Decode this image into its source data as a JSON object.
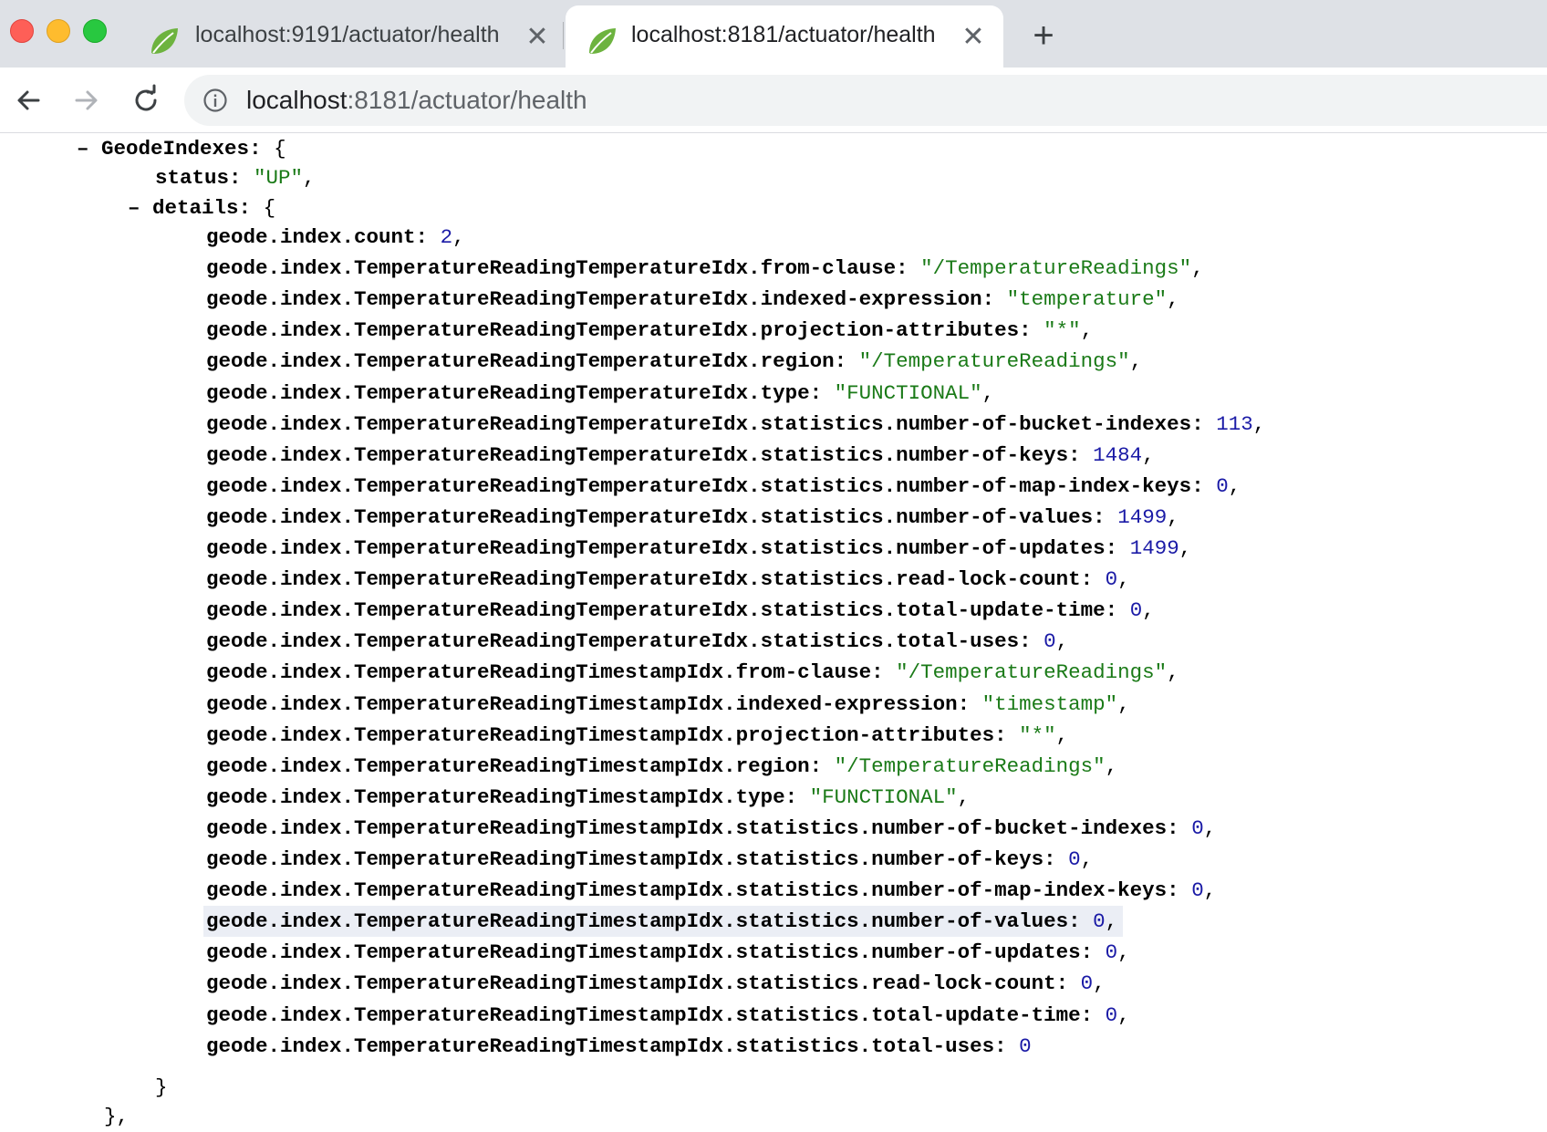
{
  "tabs": [
    {
      "title": "localhost:9191/actuator/health",
      "close": "✕"
    },
    {
      "title": "localhost:8181/actuator/health",
      "close": "✕"
    }
  ],
  "new_tab": "+",
  "address_bar": {
    "host": "localhost",
    "path": ":8181/actuator/health"
  },
  "json": {
    "collapse_toggle": "–",
    "group_key": "GeodeIndexes",
    "status_key": "status",
    "status_value": "\"UP\"",
    "details_key": "details",
    "open_brace": "{",
    "close_brace": "}",
    "close_brace_comma": "},",
    "entries": [
      {
        "key": "geode.index.count",
        "value": "2",
        "type": "num",
        "comma": ","
      },
      {
        "key": "geode.index.TemperatureReadingTemperatureIdx.from-clause",
        "value": "\"/TemperatureReadings\"",
        "type": "str",
        "comma": ","
      },
      {
        "key": "geode.index.TemperatureReadingTemperatureIdx.indexed-expression",
        "value": "\"temperature\"",
        "type": "str",
        "comma": ","
      },
      {
        "key": "geode.index.TemperatureReadingTemperatureIdx.projection-attributes",
        "value": "\"*\"",
        "type": "str",
        "comma": ","
      },
      {
        "key": "geode.index.TemperatureReadingTemperatureIdx.region",
        "value": "\"/TemperatureReadings\"",
        "type": "str",
        "comma": ","
      },
      {
        "key": "geode.index.TemperatureReadingTemperatureIdx.type",
        "value": "\"FUNCTIONAL\"",
        "type": "str",
        "comma": ","
      },
      {
        "key": "geode.index.TemperatureReadingTemperatureIdx.statistics.number-of-bucket-indexes",
        "value": "113",
        "type": "num",
        "comma": ","
      },
      {
        "key": "geode.index.TemperatureReadingTemperatureIdx.statistics.number-of-keys",
        "value": "1484",
        "type": "num",
        "comma": ","
      },
      {
        "key": "geode.index.TemperatureReadingTemperatureIdx.statistics.number-of-map-index-keys",
        "value": "0",
        "type": "num",
        "comma": ","
      },
      {
        "key": "geode.index.TemperatureReadingTemperatureIdx.statistics.number-of-values",
        "value": "1499",
        "type": "num",
        "comma": ","
      },
      {
        "key": "geode.index.TemperatureReadingTemperatureIdx.statistics.number-of-updates",
        "value": "1499",
        "type": "num",
        "comma": ","
      },
      {
        "key": "geode.index.TemperatureReadingTemperatureIdx.statistics.read-lock-count",
        "value": "0",
        "type": "num",
        "comma": ","
      },
      {
        "key": "geode.index.TemperatureReadingTemperatureIdx.statistics.total-update-time",
        "value": "0",
        "type": "num",
        "comma": ","
      },
      {
        "key": "geode.index.TemperatureReadingTemperatureIdx.statistics.total-uses",
        "value": "0",
        "type": "num",
        "comma": ","
      },
      {
        "key": "geode.index.TemperatureReadingTimestampIdx.from-clause",
        "value": "\"/TemperatureReadings\"",
        "type": "str",
        "comma": ","
      },
      {
        "key": "geode.index.TemperatureReadingTimestampIdx.indexed-expression",
        "value": "\"timestamp\"",
        "type": "str",
        "comma": ","
      },
      {
        "key": "geode.index.TemperatureReadingTimestampIdx.projection-attributes",
        "value": "\"*\"",
        "type": "str",
        "comma": ","
      },
      {
        "key": "geode.index.TemperatureReadingTimestampIdx.region",
        "value": "\"/TemperatureReadings\"",
        "type": "str",
        "comma": ","
      },
      {
        "key": "geode.index.TemperatureReadingTimestampIdx.type",
        "value": "\"FUNCTIONAL\"",
        "type": "str",
        "comma": ","
      },
      {
        "key": "geode.index.TemperatureReadingTimestampIdx.statistics.number-of-bucket-indexes",
        "value": "0",
        "type": "num",
        "comma": ","
      },
      {
        "key": "geode.index.TemperatureReadingTimestampIdx.statistics.number-of-keys",
        "value": "0",
        "type": "num",
        "comma": ","
      },
      {
        "key": "geode.index.TemperatureReadingTimestampIdx.statistics.number-of-map-index-keys",
        "value": "0",
        "type": "num",
        "comma": ","
      },
      {
        "key": "geode.index.TemperatureReadingTimestampIdx.statistics.number-of-values",
        "value": "0",
        "type": "num",
        "comma": ",",
        "highlighted": true
      },
      {
        "key": "geode.index.TemperatureReadingTimestampIdx.statistics.number-of-updates",
        "value": "0",
        "type": "num",
        "comma": ","
      },
      {
        "key": "geode.index.TemperatureReadingTimestampIdx.statistics.read-lock-count",
        "value": "0",
        "type": "num",
        "comma": ","
      },
      {
        "key": "geode.index.TemperatureReadingTimestampIdx.statistics.total-update-time",
        "value": "0",
        "type": "num",
        "comma": ","
      },
      {
        "key": "geode.index.TemperatureReadingTimestampIdx.statistics.total-uses",
        "value": "0",
        "type": "num",
        "comma": ""
      }
    ]
  }
}
